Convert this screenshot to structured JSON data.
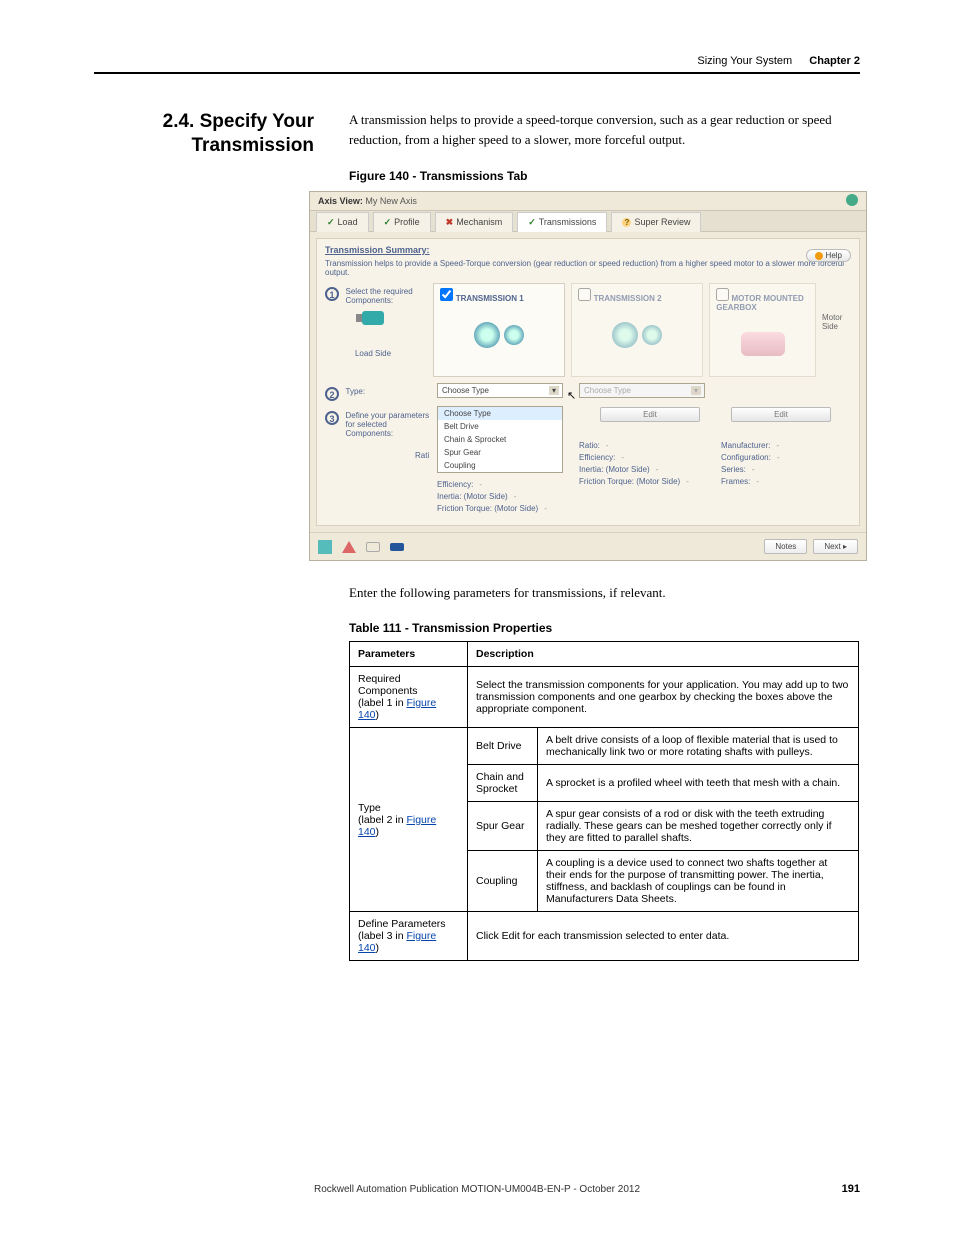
{
  "header": {
    "breadcrumb": "Sizing Your System",
    "chapter": "Chapter 2"
  },
  "section": {
    "number": "2.4.",
    "title": "Specify Your Transmission"
  },
  "intro": "A transmission helps to provide a speed-torque conversion, such as a gear reduction or speed reduction, from a higher speed to a slower, more forceful output.",
  "figure_caption": "Figure 140 - Transmissions Tab",
  "screenshot": {
    "axis_view_label": "Axis View:",
    "axis_view_value": "My New Axis",
    "tabs": {
      "load": "Load",
      "profile": "Profile",
      "mechanism": "Mechanism",
      "transmissions": "Transmissions",
      "super_review": "Super Review"
    },
    "summary_title": "Transmission Summary:",
    "summary_text": "Transmission helps to provide a Speed-Torque conversion (gear reduction or speed reduction) from a higher speed motor to a slower more forceful output.",
    "help": "Help",
    "step1": "Select the required Components:",
    "load_side": "Load Side",
    "motor_side": "Motor Side",
    "trans1": "TRANSMISSION 1",
    "trans2": "TRANSMISSION 2",
    "gearbox": "MOTOR MOUNTED GEARBOX",
    "step2": "Type:",
    "choose_type": "Choose Type",
    "dd": {
      "opt0": "Choose Type",
      "opt1": "Belt Drive",
      "opt2": "Chain & Sprocket",
      "opt3": "Spur Gear",
      "opt4": "Coupling"
    },
    "step3": "Define your parameters for selected Components:",
    "rati_stub": "Rati",
    "edit": "Edit",
    "props1": {
      "efficiency": "Efficiency:",
      "inertia": "Inertia: (Motor Side)",
      "friction": "Friction Torque: (Motor Side)"
    },
    "props2": {
      "ratio": "Ratio:",
      "efficiency": "Efficiency:",
      "inertia": "Inertia: (Motor Side)",
      "friction": "Friction Torque: (Motor Side)"
    },
    "props3": {
      "manufacturer": "Manufacturer:",
      "configuration": "Configuration:",
      "series": "Series:",
      "frames": "Frames:"
    },
    "dash": "-",
    "notes": "Notes",
    "next": "Next ▸"
  },
  "enter_text": "Enter the following parameters for transmissions, if relevant.",
  "table_caption": "Table 111 - Transmission Properties",
  "table": {
    "h1": "Parameters",
    "h2": "Description",
    "r1_param": "Required Components",
    "r1_label": "(label 1 in ",
    "figref": "Figure 140",
    "r1_desc": "Select the transmission components for your application. You may add up to two transmission components and one gearbox by checking the boxes above the appropriate component.",
    "r2_param": "Type",
    "r2_label": "(label 2 in ",
    "r2a_name": "Belt Drive",
    "r2a_desc": "A belt drive consists of a loop of flexible material that is used to mechanically link two or more rotating shafts with pulleys.",
    "r2b_name": "Chain and Sprocket",
    "r2b_desc": "A sprocket is a profiled wheel with teeth that mesh with a chain.",
    "r2c_name": "Spur Gear",
    "r2c_desc": "A spur gear consists of a rod or disk with the teeth extruding radially. These gears can be meshed together correctly only if they are fitted to parallel shafts.",
    "r2d_name": "Coupling",
    "r2d_desc": "A coupling is a device used to connect two shafts together at their ends for the purpose of transmitting power. The inertia, stiffness, and backlash of couplings can be found in Manufacturers Data Sheets.",
    "r3_param": "Define Parameters",
    "r3_label": "(label 3 in ",
    "r3_desc": "Click Edit for each transmission selected to enter data."
  },
  "footer": {
    "pub": "Rockwell Automation Publication MOTION-UM004B-EN-P - October 2012",
    "page": "191"
  }
}
